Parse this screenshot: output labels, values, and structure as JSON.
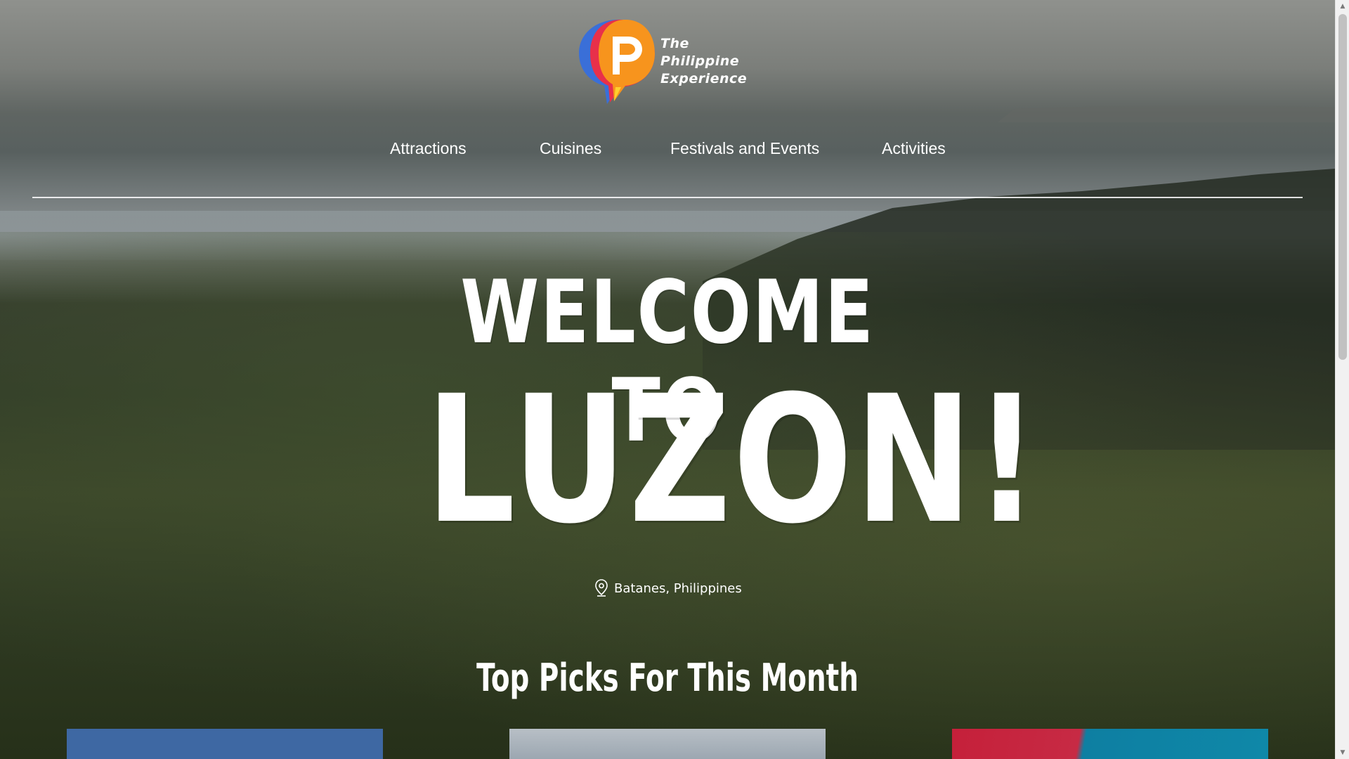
{
  "brand": {
    "logo_lines": [
      "The",
      "Philippine",
      "Experience"
    ],
    "colors": {
      "orange": "#f7941d",
      "blue": "#3a6fd8",
      "red": "#e8304a",
      "yellow": "#ffcf2e"
    }
  },
  "nav": {
    "items": [
      {
        "label": "Attractions"
      },
      {
        "label": "Cuisines"
      },
      {
        "label": "Festivals and Events"
      },
      {
        "label": "Activities"
      }
    ]
  },
  "hero": {
    "headline_line1": "WELCOME TO",
    "headline_line2": "LUZON!",
    "location": "Batanes, Philippines",
    "location_icon": "map-pin-icon"
  },
  "section": {
    "title": "Top Picks For This Month"
  },
  "cards": [
    {
      "color": "#3e68a3"
    },
    {
      "color": "#b8bfc6"
    },
    {
      "color": "#c5203a"
    }
  ]
}
